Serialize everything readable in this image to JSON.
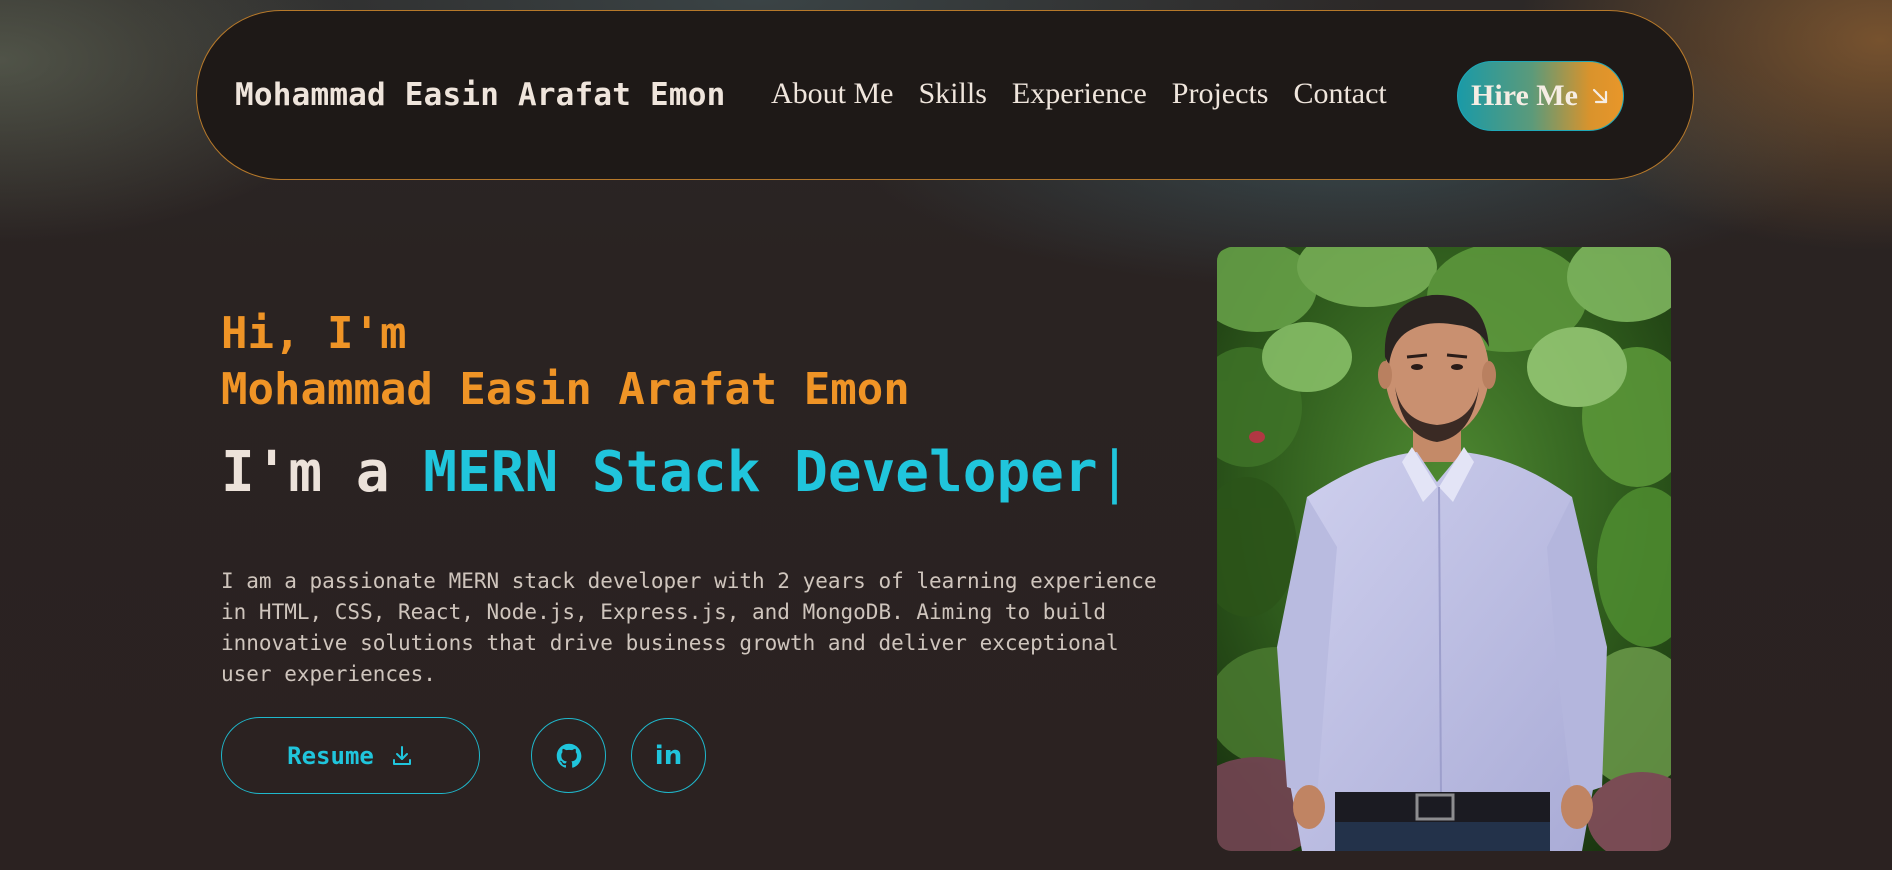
{
  "nav": {
    "brand": "Mohammad Easin Arafat Emon",
    "links": [
      "About Me",
      "Skills",
      "Experience",
      "Projects",
      "Contact"
    ],
    "hire_label": "Hire Me",
    "hire_icon": "arrow-down-right-icon"
  },
  "hero": {
    "greeting": "Hi, I'm",
    "name": "Mohammad Easin Arafat Emon",
    "role_prefix": "I'm a ",
    "role": "MERN Stack Developer",
    "cursor": "|",
    "intro": "I am a passionate MERN stack developer with 2 years of learning experience in HTML, CSS, React, Node.js, Express.js, and MongoDB. Aiming to build innovative solutions that drive business growth and deliver exceptional user experiences.",
    "resume_label": "Resume",
    "resume_icon": "download-icon",
    "social": [
      {
        "icon": "github-icon"
      },
      {
        "icon": "linkedin-icon",
        "glyph": "in"
      }
    ]
  },
  "colors": {
    "accent_orange": "#ef9426",
    "accent_cyan": "#20c5dc",
    "background": "#2a2322",
    "navbar_bg": "#1e1917"
  }
}
